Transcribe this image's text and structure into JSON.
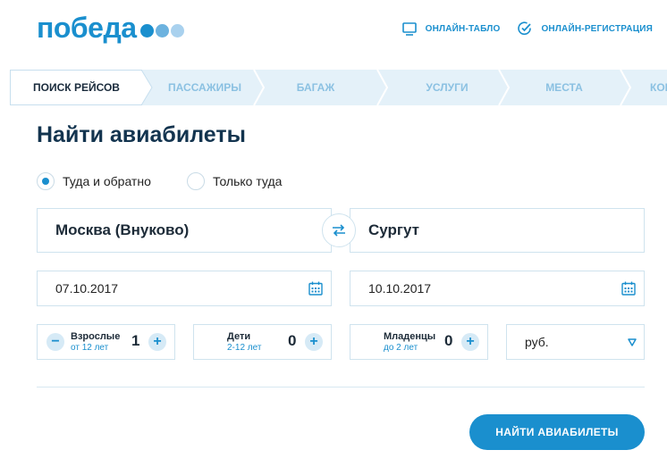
{
  "brand": {
    "logo_text": "победа",
    "accent": "#1a8fce"
  },
  "header": {
    "links": [
      {
        "label": "ОНЛАЙН-ТАБЛО",
        "icon": "monitor-icon"
      },
      {
        "label": "ОНЛАЙН-РЕГИСТРАЦИЯ",
        "icon": "check-circle-icon"
      }
    ]
  },
  "steps": [
    {
      "label": "ПОИСК РЕЙСОВ",
      "active": true
    },
    {
      "label": "ПАССАЖИРЫ",
      "active": false
    },
    {
      "label": "БАГАЖ",
      "active": false
    },
    {
      "label": "УСЛУГИ",
      "active": false
    },
    {
      "label": "МЕСТА",
      "active": false
    },
    {
      "label": "КОНТАКТЫ",
      "active": false
    }
  ],
  "form": {
    "title": "Найти авиабилеты",
    "trip_type": [
      {
        "label": "Туда и обратно",
        "selected": true
      },
      {
        "label": "Только туда",
        "selected": false
      }
    ],
    "origin": "Москва (Внуково)",
    "destination": "Сургут",
    "depart_date": "07.10.2017",
    "return_date": "10.10.2017",
    "passengers": {
      "adults": {
        "label": "Взрослые",
        "sub": "от 12 лет",
        "value": "1"
      },
      "children": {
        "label": "Дети",
        "sub": "2-12 лет",
        "value": "0"
      },
      "infants": {
        "label": "Младенцы",
        "sub": "до 2 лет",
        "value": "0"
      }
    },
    "currency": "руб.",
    "submit_label": "НАЙТИ АВИАБИЛЕТЫ"
  }
}
